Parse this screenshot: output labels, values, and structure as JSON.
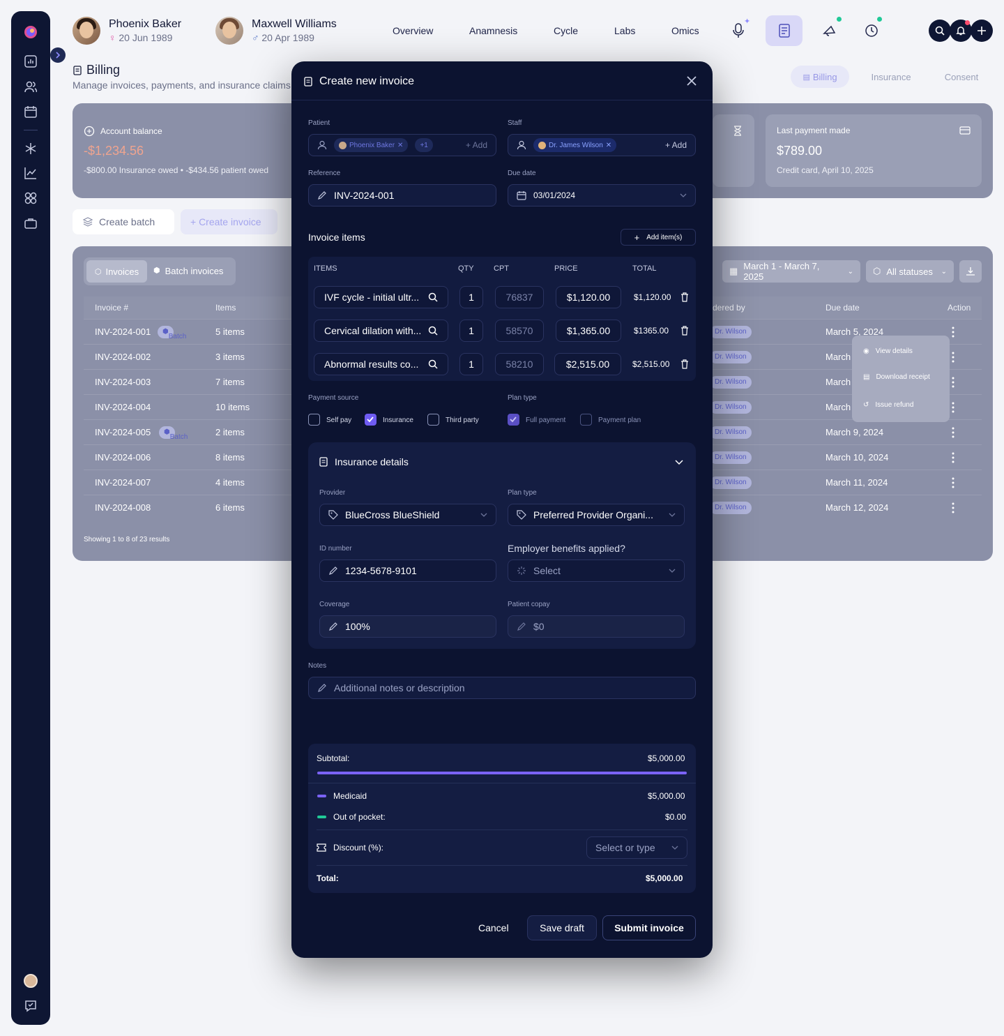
{
  "patients": [
    {
      "name": "Phoenix Baker",
      "dob": "20 Jun 1989"
    },
    {
      "name": "Maxwell Williams",
      "dob": "20 Apr 1989"
    }
  ],
  "nav": [
    "Overview",
    "Anamnesis",
    "Cycle",
    "Labs",
    "Omics"
  ],
  "page": {
    "title": "Billing",
    "subtitle": "Manage invoices, payments, and insurance claims",
    "tabs": [
      "Billing",
      "Insurance",
      "Consent"
    ]
  },
  "balance": {
    "label": "Account balance",
    "amount": "-$1,234.56",
    "detail": "-$800.00 Insurance owed • -$434.56 patient owed"
  },
  "last_payment": {
    "label": "Last payment made",
    "amount": "$789.00",
    "detail": "Credit card, April 10, 2025"
  },
  "actions": {
    "create_batch": "Create batch",
    "create_invoice": "+ Create invoice"
  },
  "list_tabs": [
    "Invoices",
    "Batch invoices"
  ],
  "filters": {
    "date_range": "March 1 - March 7, 2025",
    "status": "All statuses"
  },
  "table": {
    "headers": {
      "invoice": "Invoice #",
      "items": "Items",
      "ordered_by": "dered by",
      "due": "Due date",
      "action": "Action"
    },
    "rows": [
      {
        "id": "INV-2024-001",
        "batch": "Batch",
        "items": "5 items",
        "doctor": "Dr. Wilson",
        "due": "March 5, 2024"
      },
      {
        "id": "INV-2024-002",
        "batch": "",
        "items": "3 items",
        "doctor": "Dr. Wilson",
        "due": "March"
      },
      {
        "id": "INV-2024-003",
        "batch": "",
        "items": "7 items",
        "doctor": "Dr. Wilson",
        "due": "March"
      },
      {
        "id": "INV-2024-004",
        "batch": "",
        "items": "10 items",
        "doctor": "Dr. Wilson",
        "due": "March"
      },
      {
        "id": "INV-2024-005",
        "batch": "Batch",
        "items": "2 items",
        "doctor": "Dr. Wilson",
        "due": "March 9, 2024"
      },
      {
        "id": "INV-2024-006",
        "batch": "",
        "items": "8 items",
        "doctor": "Dr. Wilson",
        "due": "March 10, 2024"
      },
      {
        "id": "INV-2024-007",
        "batch": "",
        "items": "4 items",
        "doctor": "Dr. Wilson",
        "due": "March 11, 2024"
      },
      {
        "id": "INV-2024-008",
        "batch": "",
        "items": "6 items",
        "doctor": "Dr. Wilson",
        "due": "March 12, 2024"
      }
    ],
    "footer": "Showing 1 to 8 of 23 results"
  },
  "context_menu": [
    "View details",
    "Download receipt",
    "Issue refund"
  ],
  "modal": {
    "title": "Create new invoice",
    "patient_label": "Patient",
    "patient_chip": "Phoenix Baker",
    "patient_more": "+1",
    "add": "+ Add",
    "staff_label": "Staff",
    "staff_chip": "Dr. James Wilson",
    "reference_label": "Reference",
    "reference_value": "INV-2024-001",
    "due_label": "Due date",
    "due_value": "03/01/2024",
    "items_title": "Invoice items",
    "add_items": "Add item(s)",
    "item_headers": [
      "ITEMS",
      "QTY",
      "CPT",
      "PRICE",
      "TOTAL"
    ],
    "items": [
      {
        "name": "IVF cycle - initial ultr...",
        "qty": "1",
        "cpt": "76837",
        "price": "$1,120.00",
        "total": "$1,120.00"
      },
      {
        "name": "Cervical dilation with...",
        "qty": "1",
        "cpt": "58570",
        "price": "$1,365.00",
        "total": "$1365.00"
      },
      {
        "name": "Abnormal results co...",
        "qty": "1",
        "cpt": "58210",
        "price": "$2,515.00",
        "total": "$2,515.00"
      }
    ],
    "payment_source_label": "Payment source",
    "payment_sources": [
      "Self pay",
      "Insurance",
      "Third party"
    ],
    "plan_type_label": "Plan type",
    "plan_types": [
      "Full payment",
      "Payment plan"
    ],
    "insurance": {
      "title": "Insurance details",
      "provider_label": "Provider",
      "provider": "BlueCross BlueShield",
      "plan_label": "Plan type",
      "plan": "Preferred Provider Organi...",
      "id_label": "ID number",
      "id_value": "1234-5678-9101",
      "employer_label": "Employer benefits applied?",
      "employer_placeholder": "Select",
      "coverage_label": "Coverage",
      "coverage": "100%",
      "copay_label": "Patient copay",
      "copay": "$0"
    },
    "notes_label": "Notes",
    "notes_placeholder": "Additional notes or description",
    "summary": {
      "subtotal_label": "Subtotal:",
      "subtotal": "$5,000.00",
      "medicaid_label": "Medicaid",
      "medicaid": "$5,000.00",
      "oop_label": "Out of pocket:",
      "oop": "$0.00",
      "discount_label": "Discount (%):",
      "discount_placeholder": "Select or type",
      "total_label": "Total:",
      "total": "$5,000.00"
    },
    "cancel": "Cancel",
    "save_draft": "Save draft",
    "submit": "Submit invoice"
  },
  "colors": {
    "accent": "#6f5cf2",
    "success": "#20c997",
    "negative": "#f0a48f"
  }
}
